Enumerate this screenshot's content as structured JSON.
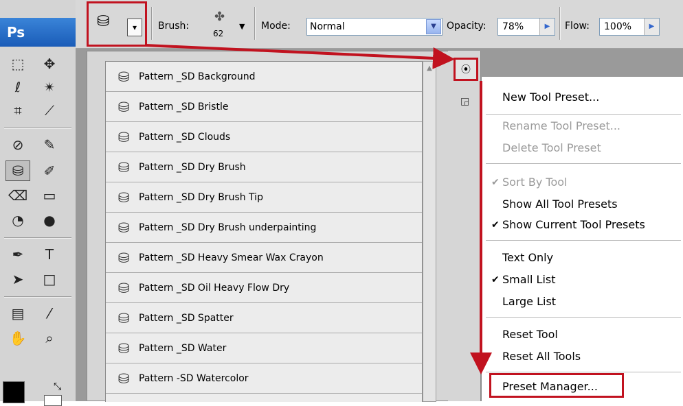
{
  "app": {
    "logo": "Ps"
  },
  "options_bar": {
    "brush_label": "Brush:",
    "brush_size": "62",
    "mode_label": "Mode:",
    "mode_value": "Normal",
    "opacity_label": "Opacity:",
    "opacity_value": "78%",
    "flow_label": "Flow:",
    "flow_value": "100%"
  },
  "preset_list": [
    "Pattern _SD Background",
    "Pattern _SD Bristle",
    "Pattern _SD Clouds",
    "Pattern _SD Dry Brush",
    "Pattern _SD Dry Brush Tip",
    "Pattern _SD Dry Brush underpainting",
    "Pattern _SD Heavy Smear Wax Crayon",
    "Pattern _SD Oil Heavy Flow Dry",
    "Pattern _SD Spatter",
    "Pattern _SD Water",
    "Pattern -SD Watercolor"
  ],
  "menu": {
    "new_tool_preset": "New Tool Preset...",
    "rename_tool_preset": "Rename Tool Preset...",
    "delete_tool_preset": "Delete Tool Preset",
    "sort_by_tool": "Sort By Tool",
    "show_all_tool_presets": "Show All Tool Presets",
    "show_current_tool_presets": "Show Current Tool Presets",
    "text_only": "Text Only",
    "small_list": "Small List",
    "large_list": "Large List",
    "reset_tool": "Reset Tool",
    "reset_all_tools": "Reset All Tools",
    "preset_manager": "Preset Manager..."
  },
  "annotation_color": "#c1121f"
}
